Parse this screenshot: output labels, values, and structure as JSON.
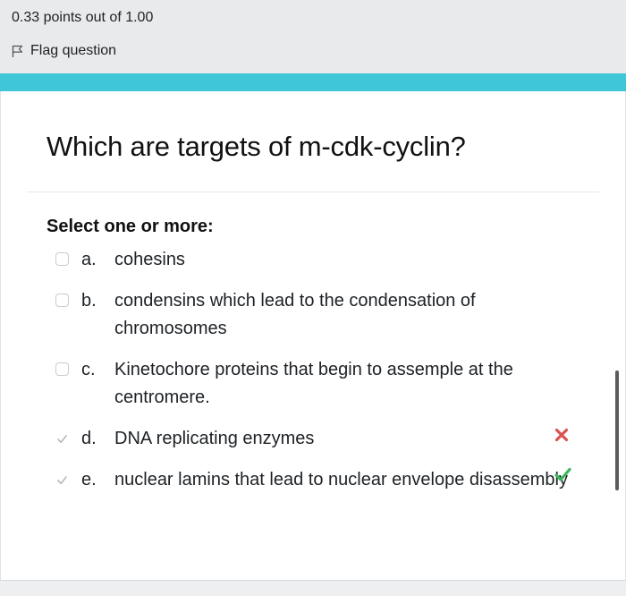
{
  "info": {
    "grade": "0.33 points out of 1.00",
    "flag_label": "Flag question"
  },
  "question": {
    "text": "Which are targets of m-cdk-cyclin?",
    "prompt": "Select one or more:"
  },
  "options": [
    {
      "letter": "a.",
      "text": "cohesins",
      "checked": false
    },
    {
      "letter": "b.",
      "text": "condensins which lead to the condensation of chromosomes",
      "checked": false
    },
    {
      "letter": "c.",
      "text": "Kinetochore proteins that begin to assemple at the centromere.",
      "checked": false
    },
    {
      "letter": "d.",
      "text": "DNA replicating enzymes",
      "checked": true,
      "feedback": "incorrect"
    },
    {
      "letter": "e.",
      "text": "nuclear lamins that lead to nuclear envelope disassembly",
      "checked": true,
      "feedback": "correct"
    }
  ],
  "colors": {
    "accent": "#3fc6d7",
    "incorrect": "#d9534f",
    "correct": "#3cb55e"
  },
  "icons": {
    "flag": "flag-outline-icon",
    "checkbox_checked": "check-icon",
    "incorrect": "cross-icon",
    "correct": "check-icon"
  }
}
